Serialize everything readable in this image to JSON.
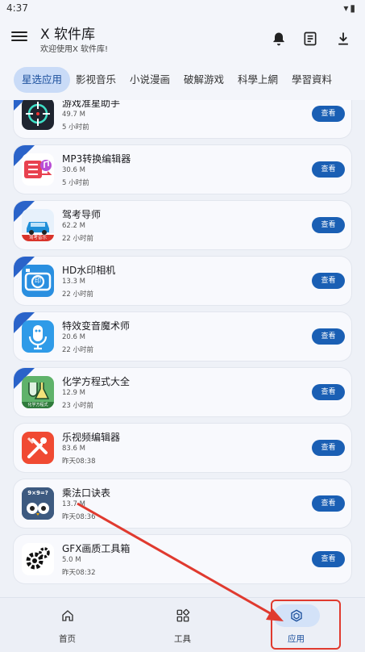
{
  "status": {
    "time": "4:37"
  },
  "header": {
    "title": "X 软件库",
    "subtitle": "欢迎使用X 软件库!"
  },
  "tabs": [
    {
      "label": "星选应用",
      "active": true
    },
    {
      "label": "影视音乐",
      "active": false
    },
    {
      "label": "小说漫画",
      "active": false
    },
    {
      "label": "破解游戏",
      "active": false
    },
    {
      "label": "科學上網",
      "active": false
    },
    {
      "label": "學習資料",
      "active": false
    }
  ],
  "apps": [
    {
      "name": "游戏准星助手",
      "size": "49.7 M",
      "time": "5 小时前",
      "button": "查看",
      "featured": true,
      "icon": "crosshair-icon"
    },
    {
      "name": "MP3转换编辑器",
      "size": "30.6 M",
      "time": "5 小时前",
      "button": "查看",
      "featured": true,
      "icon": "music-convert-icon"
    },
    {
      "name": "驾考导师",
      "size": "62.2 M",
      "time": "22 小时前",
      "button": "查看",
      "featured": true,
      "icon": "car-icon",
      "icon_caption": "驾考音乐"
    },
    {
      "name": "HD水印相机",
      "size": "13.3 M",
      "time": "22 小时前",
      "button": "查看",
      "featured": true,
      "icon": "watermark-camera-icon",
      "icon_caption": "印"
    },
    {
      "name": "特效变音魔术师",
      "size": "20.6 M",
      "time": "22 小时前",
      "button": "查看",
      "featured": true,
      "icon": "microphone-icon"
    },
    {
      "name": "化学方程式大全",
      "size": "12.9 M",
      "time": "23 小时前",
      "button": "查看",
      "featured": true,
      "icon": "chemistry-flask-icon",
      "icon_caption": "化学方程式"
    },
    {
      "name": "乐视频编辑器",
      "size": "83.6 M",
      "time": "昨天08:38",
      "button": "查看",
      "featured": false,
      "icon": "video-editor-icon"
    },
    {
      "name": "乘法口诀表",
      "size": "13.7 M",
      "time": "昨天08:36",
      "button": "查看",
      "featured": false,
      "icon": "multiplication-owl-icon",
      "icon_caption": "9×9=?"
    },
    {
      "name": "GFX画质工具箱",
      "size": "5.0 M",
      "time": "昨天08:32",
      "button": "查看",
      "featured": false,
      "icon": "gears-icon"
    }
  ],
  "bottom_nav": [
    {
      "label": "首页",
      "icon": "home-icon",
      "active": false
    },
    {
      "label": "工具",
      "icon": "tools-grid-icon",
      "active": false
    },
    {
      "label": "应用",
      "icon": "app-cube-icon",
      "active": true
    }
  ],
  "colors": {
    "accent": "#1a5fb4",
    "annotation": "#e03a2f",
    "active_tab_bg": "#c9dbf7"
  }
}
